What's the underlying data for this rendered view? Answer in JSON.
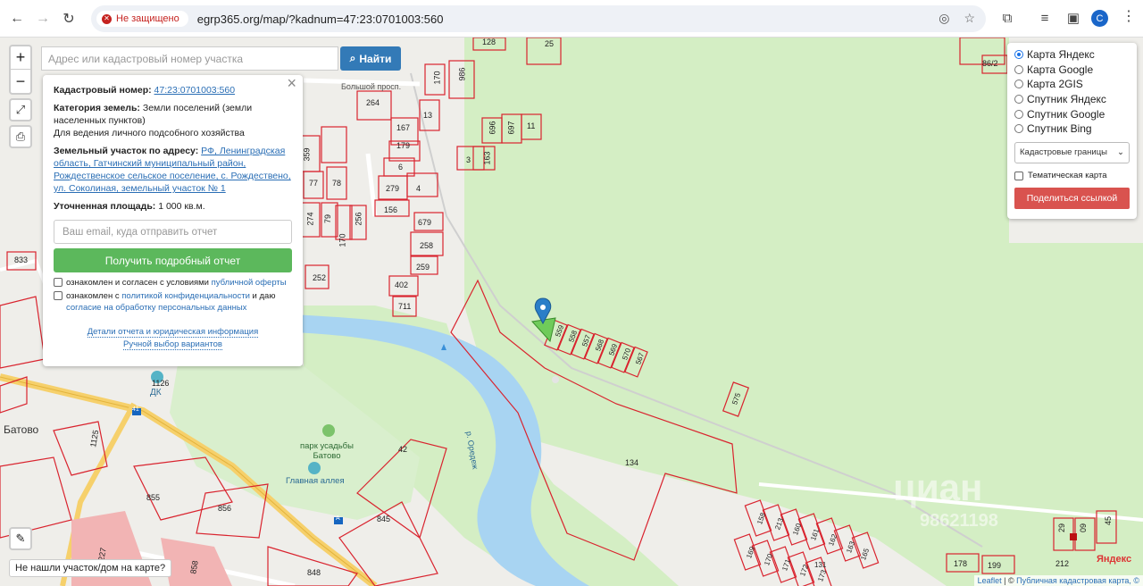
{
  "browser": {
    "not_secure": "Не защищено",
    "url": "egrp365.org/map/?kadnum=47:23:0701003:560",
    "profile_initial": "C"
  },
  "search": {
    "placeholder": "Адрес или кадастровый номер участка",
    "button": "Найти"
  },
  "info": {
    "cadastral_label": "Кадастровый номер:",
    "cadastral_value": "47:23:0701003:560",
    "category_label": "Категория земель:",
    "category_value": "Земли поселений (земли населенных пунктов)",
    "usage": "Для ведения личного подсобного хозяйства",
    "address_label": "Земельный участок по адресу:",
    "address_value": "РФ, Ленинградская область, Гатчинский муниципальный район, Рождественское сельское поселение, с. Рождествено, ул. Соколиная, земельный участок № 1",
    "area_label": "Уточненная площадь:",
    "area_value": "1 000 кв.м.",
    "email_placeholder": "Ваш email, куда отправить отчет",
    "report_button": "Получить подробный отчет",
    "consent1_prefix": "ознакомлен и согласен с условиями ",
    "consent1_link": "публичной оферты",
    "consent2_prefix": "ознакомлен с ",
    "consent2_link1": "политикой конфиденциальности",
    "consent2_mid": " и даю ",
    "consent2_link2": "согласие на обработку персональных данных",
    "details_link": "Детали отчета и юридическая информация",
    "manual_link": "Ручной выбор вариантов"
  },
  "layers": {
    "options": [
      {
        "label": "Карта Яндекс",
        "selected": true
      },
      {
        "label": "Карта Google",
        "selected": false
      },
      {
        "label": "Карта 2GIS",
        "selected": false
      },
      {
        "label": "Спутник Яндекс",
        "selected": false
      },
      {
        "label": "Спутник Google",
        "selected": false
      },
      {
        "label": "Спутник Bing",
        "selected": false
      }
    ],
    "select_value": "Кадастровые границы",
    "thematic": "Тематическая карта",
    "share_button": "Поделиться ссылкой"
  },
  "not_found": "Не нашли участок/дом на карте?",
  "map_labels": {
    "batovo": "Батово",
    "park": "парк усадьбы\nБатово",
    "alley": "Главная аллея",
    "dk": "ДК",
    "river": "р. Оредеж",
    "street": "Большой просп.",
    "road_badge": "41",
    "road_badge2": "А"
  },
  "plots": [
    "128",
    "25",
    "986",
    "170",
    "264",
    "167",
    "13",
    "179",
    "696",
    "697",
    "11",
    "3",
    "163",
    "359",
    "6",
    "77",
    "279",
    "4",
    "78",
    "156",
    "274",
    "79",
    "256",
    "170",
    "679",
    "258",
    "259",
    "252",
    "833",
    "402",
    "711",
    "559",
    "558",
    "557",
    "568",
    "569",
    "570",
    "567",
    "575",
    "134",
    "42",
    "1125",
    "1126",
    "855",
    "856",
    "858",
    "845",
    "848",
    "9227",
    "158",
    "213",
    "160",
    "161",
    "162",
    "163",
    "169",
    "170",
    "171",
    "172",
    "173",
    "131",
    "165",
    "178",
    "212",
    "199",
    "29",
    "09",
    "45",
    "86/2"
  ],
  "attribution": {
    "leaflet": "Leaflet",
    "text": " | © ",
    "pkk": "Публичная кадастровая карта, ©"
  },
  "watermark": "циан",
  "watermark_phone": "98621198",
  "yandex": "Яндекс",
  "colors": {
    "plot_border": "#d9232e",
    "forest": "#d4eec4",
    "water": "#a8d4f2",
    "selected_plot": "#6fcb5a"
  }
}
